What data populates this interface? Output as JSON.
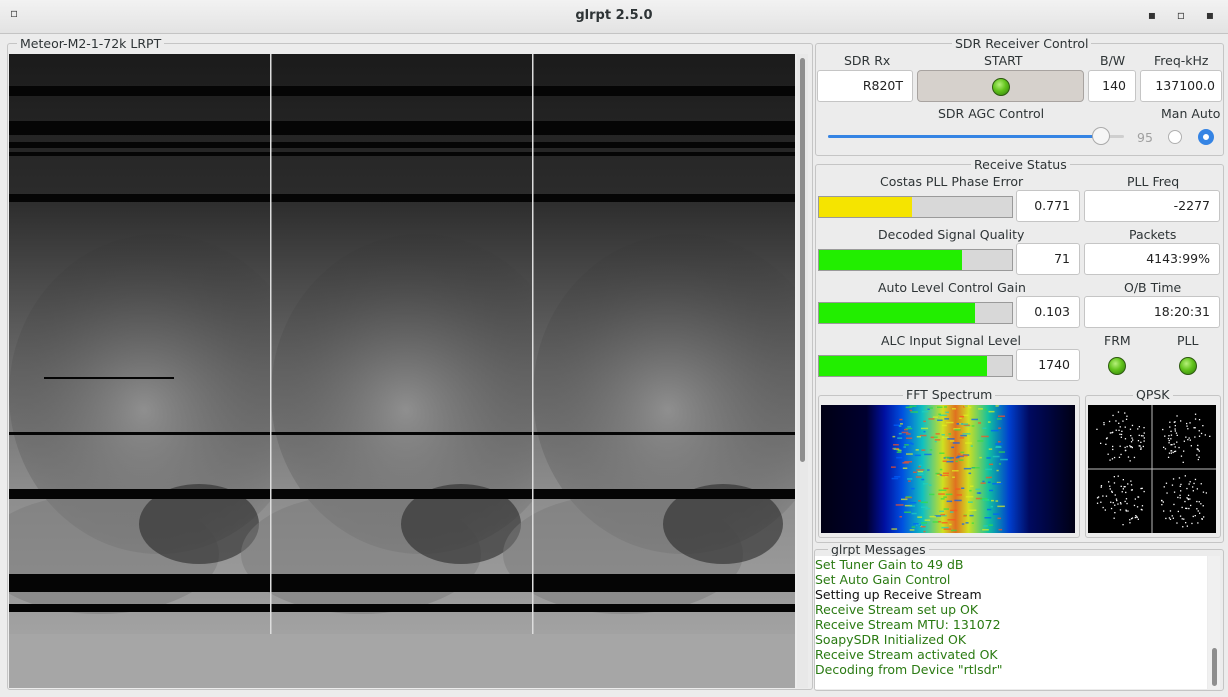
{
  "window": {
    "title": "glrpt 2.5.0",
    "menu_glyph": "▫",
    "minimize_glyph": "▪",
    "maximize_glyph": "▫",
    "close_glyph": "▪"
  },
  "image_panel": {
    "label": "Meteor-M2-1-72k LRPT",
    "channel_count": 3
  },
  "sdr_control": {
    "title": "SDR Receiver Control",
    "sdr_rx_label": "SDR Rx",
    "sdr_rx_value": "R820T",
    "start_label": "START",
    "bw_label": "B/W",
    "bw_value": "140",
    "freq_label": "Freq-kHz",
    "freq_value": "137100.0",
    "agc_label": "SDR AGC Control",
    "man_auto_label": "Man Auto",
    "agc_gain_value": "95",
    "agc_gain_fraction": 0.95,
    "agc_mode": "Auto"
  },
  "receive_status": {
    "title": "Receive Status",
    "costas_label": "Costas PLL Phase Error",
    "costas_value": "0.771",
    "costas_fraction": 0.48,
    "pll_freq_label": "PLL Freq",
    "pll_freq_value": "-2277",
    "signal_quality_label": "Decoded Signal Quality",
    "signal_quality_value": "71",
    "signal_quality_fraction": 0.74,
    "packets_label": "Packets",
    "packets_value": "4143:99%",
    "alc_gain_label": "Auto Level Control Gain",
    "alc_gain_value": "0.103",
    "alc_gain_fraction": 0.81,
    "ob_time_label": "O/B Time",
    "ob_time_value": "18:20:31",
    "alc_input_label": "ALC Input Signal Level",
    "alc_input_value": "1740",
    "alc_input_fraction": 0.87,
    "frm_label": "FRM",
    "pll_label": "PLL",
    "fft_label": "FFT Spectrum",
    "qpsk_label": "QPSK"
  },
  "colors": {
    "bar_yellow": "#f5e400",
    "bar_green": "#22ee00",
    "message_green": "#2a7a12",
    "message_black": "#111111",
    "radio_blue": "#3584e4"
  },
  "messages": {
    "title": "glrpt Messages",
    "lines": [
      {
        "text": "Set Tuner Gain to 49 dB",
        "color": "#2a7a12"
      },
      {
        "text": "Set Auto Gain Control",
        "color": "#2a7a12"
      },
      {
        "text": "Setting up Receive Stream",
        "color": "#111111"
      },
      {
        "text": "Receive Stream set up OK",
        "color": "#2a7a12"
      },
      {
        "text": "Receive Stream MTU: 131072",
        "color": "#2a7a12"
      },
      {
        "text": "SoapySDR Initialized OK",
        "color": "#2a7a12"
      },
      {
        "text": "Receive Stream activated OK",
        "color": "#2a7a12"
      },
      {
        "text": "Decoding from Device \"rtlsdr\"",
        "color": "#2a7a12"
      }
    ]
  }
}
